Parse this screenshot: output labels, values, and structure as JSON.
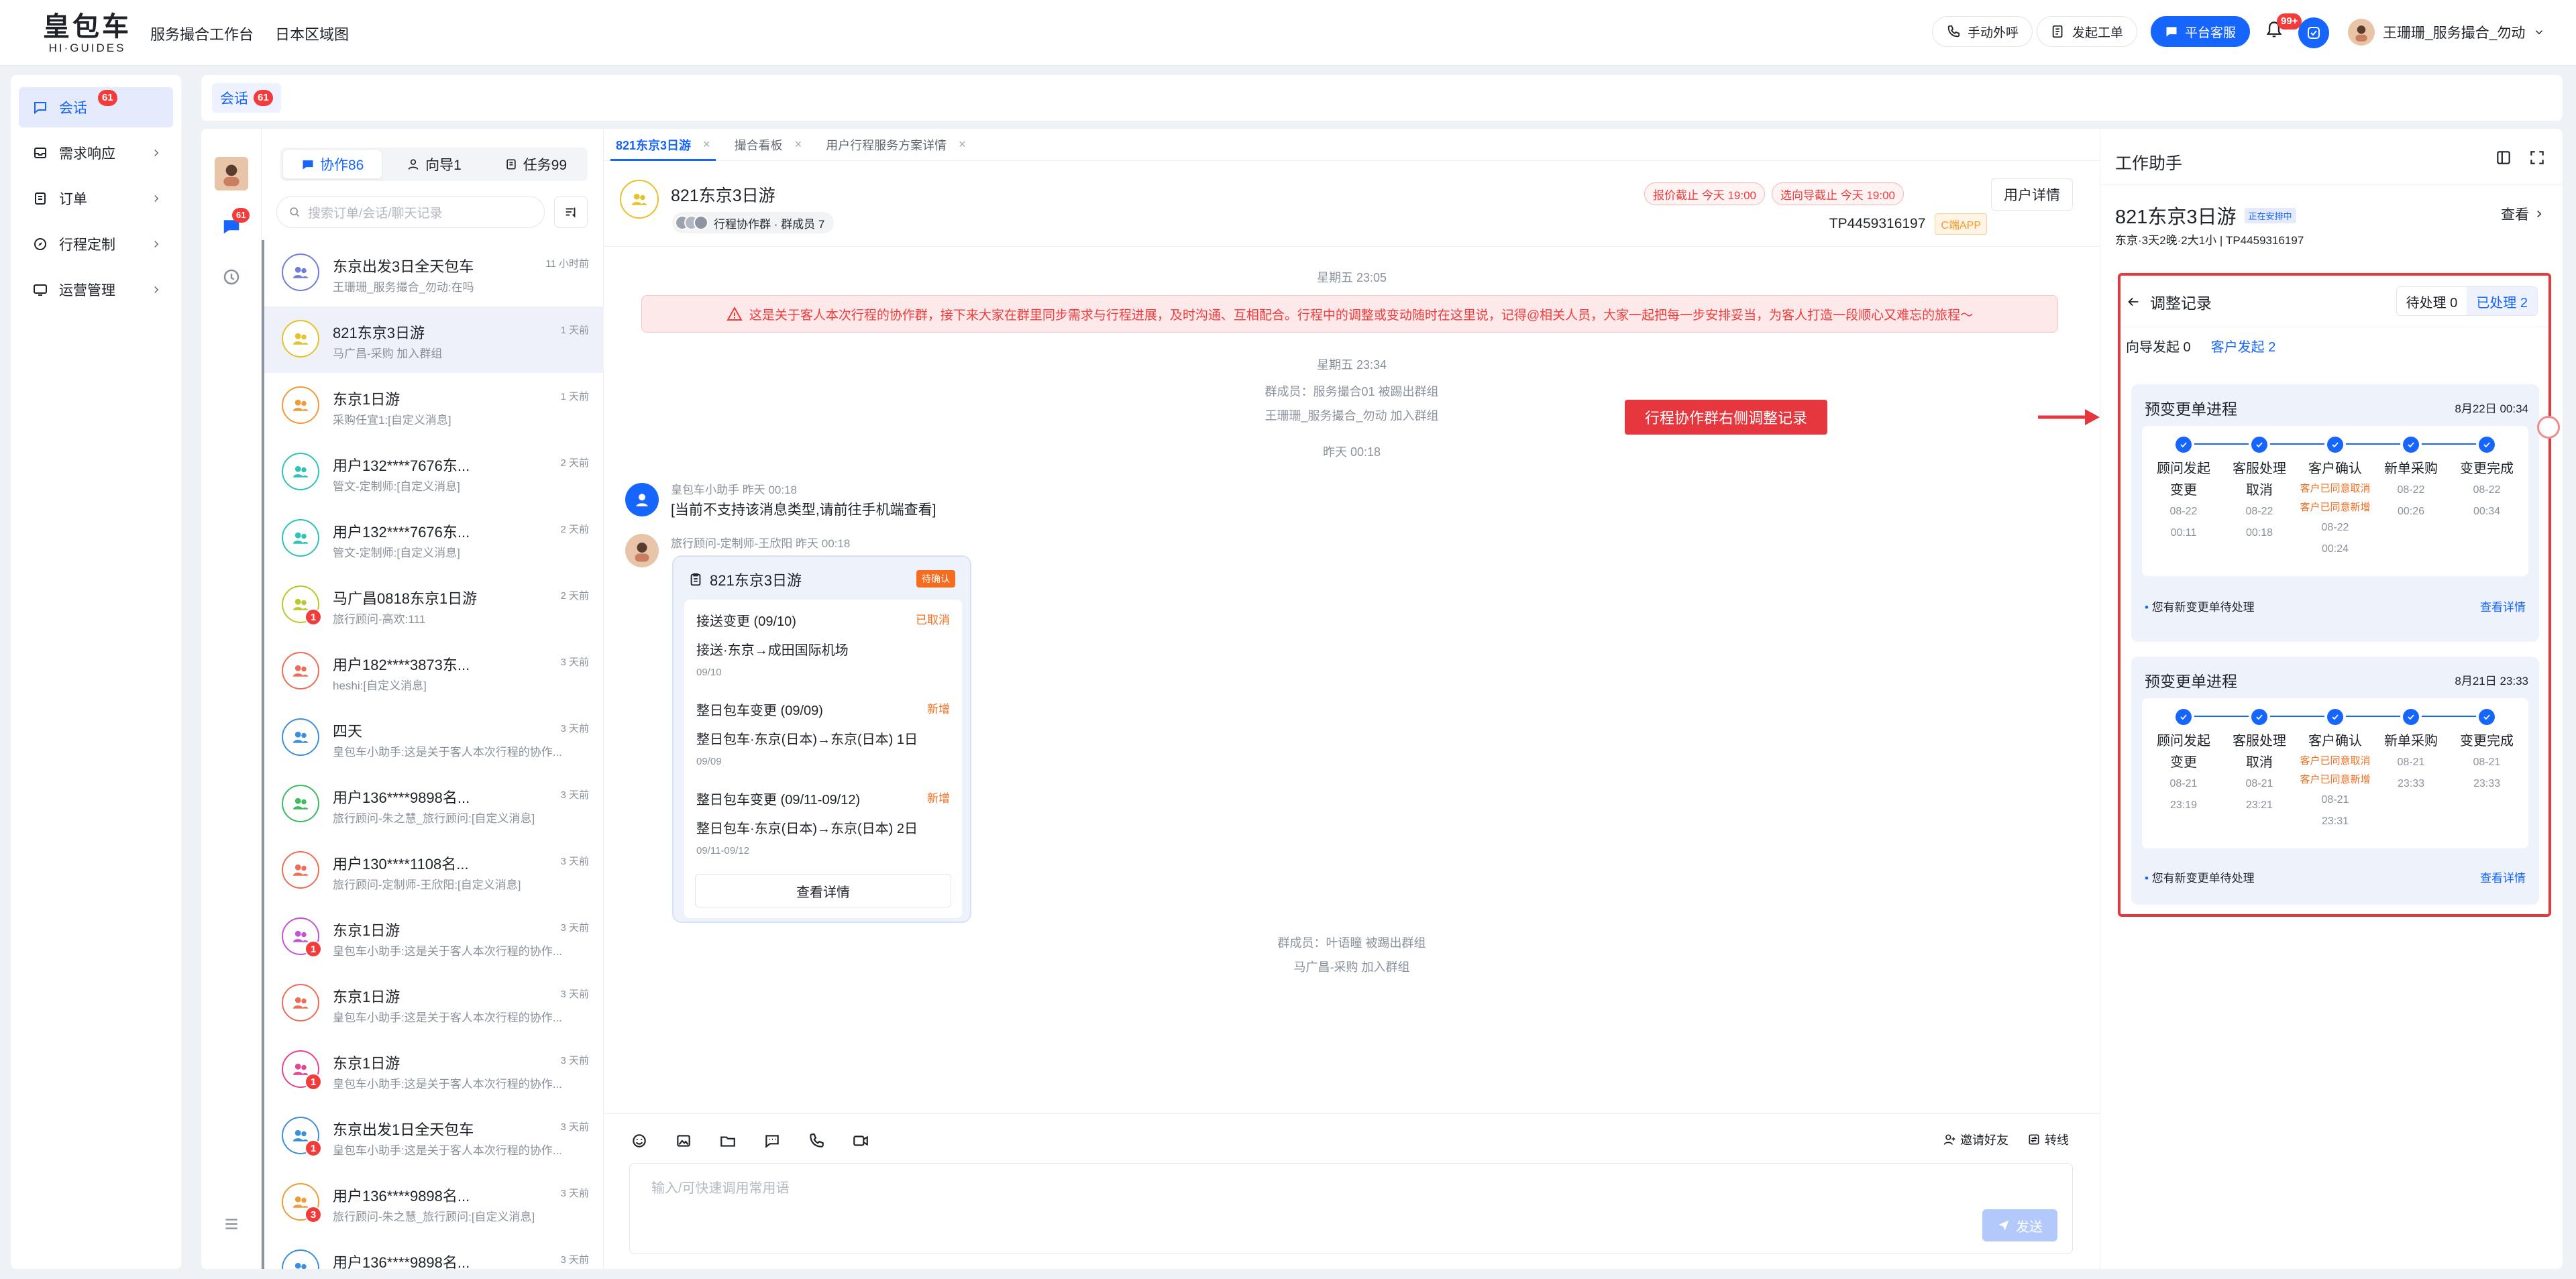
{
  "header": {
    "logo_cn": "皇包车",
    "logo_en": "HI·GUIDES",
    "nav": [
      "服务撮合工作台",
      "日本区域图"
    ],
    "btn_call": "手动外呼",
    "btn_ticket": "发起工单",
    "btn_service": "平台客服",
    "bell_badge": "99+",
    "user_name": "王珊珊_服务撮合_勿动"
  },
  "sidebar": {
    "items": [
      {
        "label": "会话",
        "badge": "61"
      },
      {
        "label": "需求响应"
      },
      {
        "label": "订单"
      },
      {
        "label": "行程定制"
      },
      {
        "label": "运营管理"
      }
    ]
  },
  "tabbar": {
    "label": "会话",
    "badge": "61"
  },
  "rail": {
    "badge": "61"
  },
  "convlist": {
    "tabs": [
      {
        "label": "协作86"
      },
      {
        "label": "向导1"
      },
      {
        "label": "任务99"
      }
    ],
    "search_placeholder": "搜索订单/会话/聊天记录",
    "items": [
      {
        "name": "东京出发3日全天包车",
        "time": "11 小时前",
        "preview": "王珊珊_服务撮合_勿动:在吗",
        "color": "#6f7dd9",
        "badge": ""
      },
      {
        "name": "821东京3日游",
        "time": "1 天前",
        "preview": "马广昌-采购 加入群组",
        "color": "#e6c12a",
        "badge": ""
      },
      {
        "name": "东京1日游",
        "time": "1 天前",
        "preview": "采购任宜1:[自定义消息]",
        "color": "#f19a38",
        "badge": ""
      },
      {
        "name": "用户132****7676东...",
        "time": "2 天前",
        "preview": "管文-定制师:[自定义消息]",
        "color": "#2dc3b7",
        "badge": ""
      },
      {
        "name": "用户132****7676东...",
        "time": "2 天前",
        "preview": "管文-定制师:[自定义消息]",
        "color": "#2dc3b7",
        "badge": ""
      },
      {
        "name": "马广昌0818东京1日游",
        "time": "2 天前",
        "preview": "旅行顾问-高欢:111",
        "color": "#b8c929",
        "badge": "1"
      },
      {
        "name": "用户182****3873东...",
        "time": "3 天前",
        "preview": "heshi:[自定义消息]",
        "color": "#f06d55",
        "badge": ""
      },
      {
        "name": "四天",
        "time": "3 天前",
        "preview": "皇包车小助手:这是关于客人本次行程的协作...",
        "color": "#3d8fdc",
        "badge": ""
      },
      {
        "name": "用户136****9898名...",
        "time": "3 天前",
        "preview": "旅行顾问-朱之慧_旅行顾问:[自定义消息]",
        "color": "#3dbb5e",
        "badge": ""
      },
      {
        "name": "用户130****1108名...",
        "time": "3 天前",
        "preview": "旅行顾问-定制师-王欣阳:[自定义消息]",
        "color": "#f06d55",
        "badge": ""
      },
      {
        "name": "东京1日游",
        "time": "3 天前",
        "preview": "皇包车小助手:这是关于客人本次行程的协作...",
        "color": "#c454d6",
        "badge": "1"
      },
      {
        "name": "东京1日游",
        "time": "3 天前",
        "preview": "皇包车小助手:这是关于客人本次行程的协作...",
        "color": "#f06d55",
        "badge": ""
      },
      {
        "name": "东京1日游",
        "time": "3 天前",
        "preview": "皇包车小助手:这是关于客人本次行程的协作...",
        "color": "#e5448f",
        "badge": "1"
      },
      {
        "name": "东京出发1日全天包车",
        "time": "3 天前",
        "preview": "皇包车小助手:这是关于客人本次行程的协作...",
        "color": "#3d8fdc",
        "badge": "1"
      },
      {
        "name": "用户136****9898名...",
        "time": "3 天前",
        "preview": "旅行顾问-朱之慧_旅行顾问:[自定义消息]",
        "color": "#f19a38",
        "badge": "3"
      },
      {
        "name": "用户136****9898名...",
        "time": "3 天前",
        "preview": "",
        "color": "#3d8fdc",
        "badge": ""
      }
    ]
  },
  "chat": {
    "tabs": [
      {
        "label": "821东京3日游"
      },
      {
        "label": "撮合看板"
      },
      {
        "label": "用户行程服务方案详情"
      }
    ],
    "title": "821东京3日游",
    "group_info": "行程协作群 · 群成员 7",
    "deadline_quote": "报价截止 今天 19:00",
    "deadline_guide": "选向导截止 今天 19:00",
    "user_detail": "用户详情",
    "order_no": "TP4459316197",
    "app_tag": "C端APP",
    "sys1_time": "星期五 23:05",
    "notice": "这是关于客人本次行程的协作群，接下来大家在群里同步需求与行程进展，及时沟通、互相配合。行程中的调整或变动随时在这里说，记得@相关人员，大家一起把每一步安排妥当，为客人打造一段顺心又难忘的旅程～",
    "sys2_time": "星期五 23:34",
    "sys2_line1": "群成员：服务撮合01 被踢出群组",
    "sys2_line2": "王珊珊_服务撮合_勿动 加入群组",
    "sys3_time": "昨天 00:18",
    "msg1_sender": "皇包车小助手 昨天 00:18",
    "msg1_text": "[当前不支持该消息类型,请前往手机端查看]",
    "msg2_sender": "旅行顾问-定制师-王欣阳 昨天 00:18",
    "card": {
      "title": "821东京3日游",
      "tag": "待确认",
      "groups": [
        {
          "head": "接送变更 (09/10)",
          "status": "已取消",
          "body": "接送·东京→成田国际机场",
          "date": "09/10"
        },
        {
          "head": "整日包车变更 (09/09)",
          "status": "新增",
          "body": "整日包车·东京(日本)→东京(日本) 1日",
          "date": "09/09"
        },
        {
          "head": "整日包车变更 (09/11-09/12)",
          "status": "新增",
          "body": "整日包车·东京(日本)→东京(日本) 2日",
          "date": "09/11-09/12"
        }
      ],
      "view": "查看详情"
    },
    "sys4_line1": "群成员：叶语瞳 被踢出群组",
    "sys4_line2": "马广昌-采购 加入群组",
    "invite": "邀请好友",
    "transfer": "转线",
    "input_placeholder": "输入/可快速调用常用语",
    "send": "发送"
  },
  "right": {
    "title": "工作助手",
    "trip_title": "821东京3日游",
    "trip_status": "正在安排中",
    "trip_info": "东京·3天2晚·2大1小 | TP4459316197",
    "view": "查看",
    "records_title": "调整记录",
    "tab_pending": "待处理 0",
    "tab_done": "已处理 2",
    "sub_guide": "向导发起 0",
    "sub_customer": "客户发起 2",
    "cards": [
      {
        "title": "预变更单进程",
        "date": "8月22日 00:34",
        "steps": [
          {
            "label": "顾问发起变更",
            "note": "",
            "time": "08-22 00:11"
          },
          {
            "label": "客服处理取消",
            "note": "",
            "time": "08-22 00:18"
          },
          {
            "label": "客户确认",
            "note": "客户已同意取消 客户已同意新增",
            "time": "08-22 00:24"
          },
          {
            "label": "新单采购",
            "note": "",
            "time": "08-22 00:26"
          },
          {
            "label": "变更完成",
            "note": "",
            "time": "08-22 00:34"
          }
        ],
        "foot": "您有新变更单待处理",
        "link": "查看详情"
      },
      {
        "title": "预变更单进程",
        "date": "8月21日 23:33",
        "steps": [
          {
            "label": "顾问发起变更",
            "note": "",
            "time": "08-21 23:19"
          },
          {
            "label": "客服处理取消",
            "note": "",
            "time": "08-21 23:21"
          },
          {
            "label": "客户确认",
            "note": "客户已同意取消 客户已同意新增",
            "time": "08-21 23:31"
          },
          {
            "label": "新单采购",
            "note": "",
            "time": "08-21 23:33"
          },
          {
            "label": "变更完成",
            "note": "",
            "time": "08-21 23:33"
          }
        ],
        "foot": "您有新变更单待处理",
        "link": "查看详情"
      }
    ]
  },
  "callout": "行程协作群右侧调整记录",
  "colors": {
    "primary": "#1665ff",
    "danger": "#f23c3c",
    "accent": "#f56c1f",
    "highlight": "#e5373d"
  }
}
